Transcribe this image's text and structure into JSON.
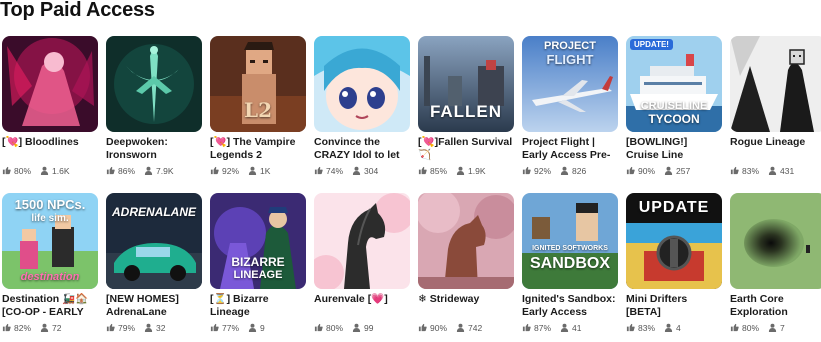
{
  "section": {
    "title": "Top Paid Access"
  },
  "thumb_text": {
    "fallen": "FALLEN",
    "project_flight_1": "PROJECT",
    "project_flight_2": "FLIGHT",
    "cruise_badge": "UPDATE!",
    "cruise_1": "CRUISELINE",
    "cruise_2": "TYCOON",
    "destination_1": "1500 NPCs.",
    "destination_2": "life sim.",
    "destination_3": "destination",
    "adrenalane": "ADRENALANE",
    "bizarre_1": "BIZARRE",
    "bizarre_2": "LINEAGE",
    "sandbox_1": "IGNITED SOFTWORKS",
    "sandbox_2": "SANDBOX",
    "mini_drifters": "UPDATE",
    "vampire": "L2"
  },
  "games": [
    {
      "title": "[💘] Bloodlines",
      "rating": "80%",
      "players": "1.6K",
      "thumb": "bloodlines"
    },
    {
      "title": "Deepwoken: Ironsworn",
      "rating": "86%",
      "players": "7.9K",
      "thumb": "deepwoken"
    },
    {
      "title": "[💘] The Vampire Legends 2",
      "rating": "92%",
      "players": "1K",
      "thumb": "vampire"
    },
    {
      "title": "Convince the CRAZY Idol to let you free",
      "rating": "74%",
      "players": "304",
      "thumb": "idol"
    },
    {
      "title": "[💘]Fallen Survival🏹",
      "rating": "85%",
      "players": "1.9K",
      "thumb": "fallen"
    },
    {
      "title": "Project Flight | Early Access Pre-Alpha",
      "rating": "92%",
      "players": "826",
      "thumb": "flight"
    },
    {
      "title": "[BOWLING!] Cruise Line Tycoon",
      "rating": "90%",
      "players": "257",
      "thumb": "cruise"
    },
    {
      "title": "Rogue Lineage",
      "rating": "83%",
      "players": "431",
      "thumb": "rogue"
    },
    {
      "title": "Destination 🚂🏠[CO-OP - EARLY",
      "rating": "82%",
      "players": "72",
      "thumb": "destination"
    },
    {
      "title": "[NEW HOMES] AdrenaLane (BETA)",
      "rating": "79%",
      "players": "32",
      "thumb": "adrenalane"
    },
    {
      "title": "[⏳] Bizarre Lineage",
      "rating": "77%",
      "players": "9",
      "thumb": "bizarre"
    },
    {
      "title": "Aurenvale [💗]",
      "rating": "80%",
      "players": "99",
      "thumb": "aurenvale"
    },
    {
      "title": "❄ Strideway",
      "rating": "90%",
      "players": "742",
      "thumb": "strideway"
    },
    {
      "title": "Ignited's Sandbox: Early Access",
      "rating": "87%",
      "players": "41",
      "thumb": "sandbox"
    },
    {
      "title": "Mini Drifters [BETA]",
      "rating": "83%",
      "players": "4",
      "thumb": "drifters"
    },
    {
      "title": "Earth Core Exploration",
      "rating": "80%",
      "players": "7",
      "thumb": "earthcore"
    }
  ],
  "icons": {
    "rating": "thumbs-up-icon",
    "players": "person-icon"
  }
}
